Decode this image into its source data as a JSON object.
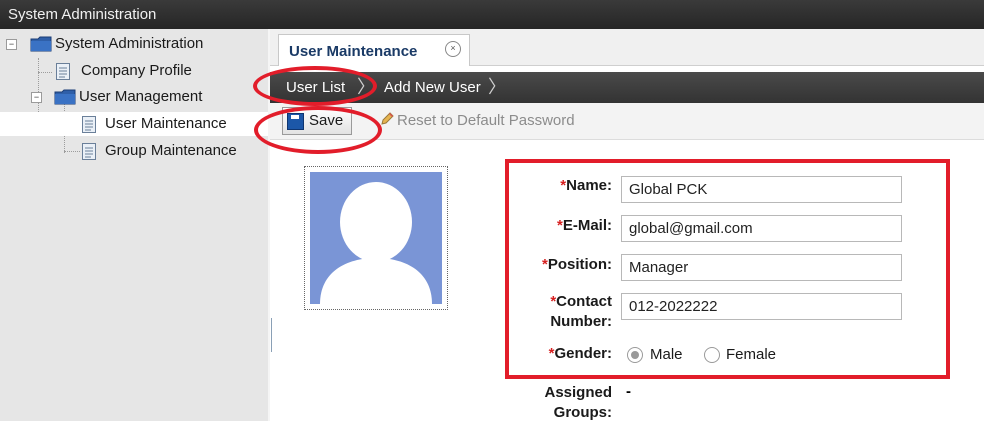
{
  "window": {
    "title": "System Administration"
  },
  "sidebar": {
    "items": [
      {
        "label": "System Administration"
      },
      {
        "label": "Company Profile"
      },
      {
        "label": "User Management"
      },
      {
        "label": "User Maintenance"
      },
      {
        "label": "Group Maintenance"
      }
    ],
    "collapse_glyph": "−"
  },
  "tabs": [
    {
      "label": "User Maintenance",
      "close_glyph": "×"
    }
  ],
  "subnav": {
    "items": [
      {
        "label": "User List"
      },
      {
        "label": "Add New User"
      }
    ],
    "separator": "〉"
  },
  "toolbar": {
    "save_label": "Save",
    "reset_label": "Reset to Default Password"
  },
  "form": {
    "required_mark": "*",
    "name": {
      "label": "Name:",
      "value": "Global PCK"
    },
    "email": {
      "label": "E-Mail:",
      "value": "global@gmail.com"
    },
    "position": {
      "label": "Position:",
      "value": "Manager"
    },
    "contact": {
      "label_line1": "Contact",
      "label_line2": "Number:",
      "value": "012-2022222"
    },
    "gender": {
      "label": "Gender:",
      "options": [
        {
          "label": "Male",
          "selected": true
        },
        {
          "label": "Female",
          "selected": false
        }
      ]
    },
    "groups": {
      "label_line1": "Assigned",
      "label_line2": "Groups:",
      "value": "-"
    }
  },
  "annotation_color": "#e21d2a",
  "accent_color": "#1a3a66"
}
